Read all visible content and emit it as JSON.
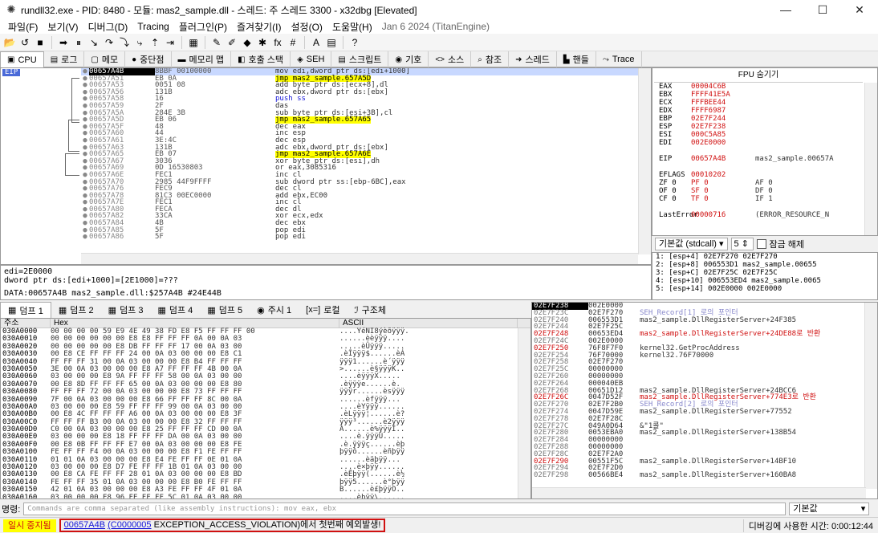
{
  "window": {
    "title": "rundll32.exe - PID: 8480 - 모듈: mas2_sample.dll - 스레드: 주 스레드 3300 - x32dbg [Elevated]",
    "buttons": [
      "—",
      "☐",
      "✕"
    ]
  },
  "menu": {
    "items": [
      "파일(F)",
      "보기(V)",
      "디버그(D)",
      "Tracing",
      "플러그인(P)",
      "즐겨찾기(I)",
      "설정(O)",
      "도움말(H)"
    ],
    "date": "Jan 6 2024 (TitanEngine)"
  },
  "toolbar": {
    "icons": [
      "open-icon",
      "restart-icon",
      "stop-icon",
      "run-icon",
      "pause-icon",
      "step-into-icon",
      "step-over-icon",
      "trace-into-icon",
      "trace-over-icon",
      "execute-till-return-icon",
      "run-to-user-code-icon",
      "scylla-icon",
      "patch-icon",
      "comment-icon",
      "label-icon",
      "bookmark-icon",
      "function-icon",
      "hash-icon",
      "font-icon",
      "calculator-icon",
      "help-icon"
    ],
    "glyphs": [
      "📂",
      "↺",
      "■",
      "➡",
      "⏸",
      "↘",
      "↷",
      "⤵",
      "⤷",
      "⇡",
      "⇥",
      "▦",
      "✎",
      "✐",
      "◆",
      "✱",
      "fx",
      "#",
      "A",
      "▤",
      "?"
    ]
  },
  "tabs": [
    {
      "label": "CPU",
      "icon": "▣"
    },
    {
      "label": "로그",
      "icon": "▤"
    },
    {
      "label": "메모",
      "icon": "▢"
    },
    {
      "label": "중단점",
      "icon": "●"
    },
    {
      "label": "메모리 맵",
      "icon": "▬"
    },
    {
      "label": "호출 스택",
      "icon": "◧"
    },
    {
      "label": "SEH",
      "icon": "◈"
    },
    {
      "label": "스크립트",
      "icon": "▤"
    },
    {
      "label": "기호",
      "icon": "◉"
    },
    {
      "label": "소스",
      "icon": "<>"
    },
    {
      "label": "참조",
      "icon": "⌕"
    },
    {
      "label": "스레드",
      "icon": "➜"
    },
    {
      "label": "핸들",
      "icon": "▙"
    },
    {
      "label": "Trace",
      "icon": "⤳"
    }
  ],
  "disasm": {
    "eip_label": "EIP",
    "rows": [
      {
        "addr": "00657A4B",
        "bytes": "8BBF 00100000",
        "ins": "mov edi,dword ptr ds:[edi+1000]",
        "kind": "cur"
      },
      {
        "addr": "00657A51",
        "bytes": "EB 0A",
        "ins": "jmp mas2_sample.657A5D",
        "kind": "jmp"
      },
      {
        "addr": "00657A53",
        "bytes": "0051 08",
        "ins": "add byte ptr ds:[ecx+8],dl",
        "kind": ""
      },
      {
        "addr": "00657A56",
        "bytes": "131B",
        "ins": "adc ebx,dword ptr ds:[ebx]",
        "kind": ""
      },
      {
        "addr": "00657A58",
        "bytes": "16",
        "ins": "push ss",
        "kind": "push"
      },
      {
        "addr": "00657A59",
        "bytes": "2F",
        "ins": "das",
        "kind": ""
      },
      {
        "addr": "00657A5A",
        "bytes": "284E 3B",
        "ins": "sub byte ptr ds:[esi+3B],cl",
        "kind": ""
      },
      {
        "addr": "00657A5D",
        "bytes": "EB 06",
        "ins": "jmp mas2_sample.657A65",
        "kind": "jmp"
      },
      {
        "addr": "00657A5F",
        "bytes": "48",
        "ins": "dec eax",
        "kind": ""
      },
      {
        "addr": "00657A60",
        "bytes": "44",
        "ins": "inc esp",
        "kind": ""
      },
      {
        "addr": "00657A61",
        "bytes": "3E:4C",
        "ins": "dec esp",
        "kind": ""
      },
      {
        "addr": "00657A63",
        "bytes": "131B",
        "ins": "adc ebx,dword ptr ds:[ebx]",
        "kind": ""
      },
      {
        "addr": "00657A65",
        "bytes": "EB 07",
        "ins": "jmp mas2_sample.657A6E",
        "kind": "jmp"
      },
      {
        "addr": "00657A67",
        "bytes": "3036",
        "ins": "xor byte ptr ds:[esi],dh",
        "kind": ""
      },
      {
        "addr": "00657A69",
        "bytes": "0D 16530803",
        "ins": "or eax,3085316",
        "kind": ""
      },
      {
        "addr": "00657A6E",
        "bytes": "FEC1",
        "ins": "inc cl",
        "kind": ""
      },
      {
        "addr": "00657A70",
        "bytes": "2985 44F9FFFF",
        "ins": "sub dword ptr ss:[ebp-6BC],eax",
        "kind": ""
      },
      {
        "addr": "00657A76",
        "bytes": "FEC9",
        "ins": "dec cl",
        "kind": ""
      },
      {
        "addr": "00657A78",
        "bytes": "81C3 00EC0000",
        "ins": "add ebx,EC00",
        "kind": ""
      },
      {
        "addr": "00657A7E",
        "bytes": "FEC1",
        "ins": "inc cl",
        "kind": ""
      },
      {
        "addr": "00657A80",
        "bytes": "FECA",
        "ins": "dec dl",
        "kind": ""
      },
      {
        "addr": "00657A82",
        "bytes": "33CA",
        "ins": "xor ecx,edx",
        "kind": ""
      },
      {
        "addr": "00657A84",
        "bytes": "4B",
        "ins": "dec ebx",
        "kind": ""
      },
      {
        "addr": "00657A85",
        "bytes": "5F",
        "ins": "pop edi",
        "kind": ""
      },
      {
        "addr": "00657A86",
        "bytes": "5F",
        "ins": "pop edi",
        "kind": ""
      }
    ]
  },
  "info": {
    "line1": "edi=2E0000",
    "line2": "dword ptr ds:[edi+1000]=[2E1000]=???",
    "line3": "DATA:00657A4B mas2_sample.dll:$257A4B #24E44B"
  },
  "fpu": {
    "header": "FPU 숨기기",
    "regs": [
      {
        "n": "EAX",
        "v": "00004C6B",
        "x": ""
      },
      {
        "n": "EBX",
        "v": "FFFF41E5A",
        "x": ""
      },
      {
        "n": "ECX",
        "v": "FFFBEE44",
        "x": ""
      },
      {
        "n": "EDX",
        "v": "FFFF6987",
        "x": ""
      },
      {
        "n": "EBP",
        "v": "02E7F244",
        "x": ""
      },
      {
        "n": "ESP",
        "v": "02E7F238",
        "x": ""
      },
      {
        "n": "ESI",
        "v": "000C5A85",
        "x": ""
      },
      {
        "n": "EDI",
        "v": "002E0000",
        "x": ""
      },
      {
        "n": "",
        "v": "",
        "x": ""
      },
      {
        "n": "EIP",
        "v": "00657A4B",
        "x": "mas2_sample.00657A"
      },
      {
        "n": "",
        "v": "",
        "x": ""
      },
      {
        "n": "EFLAGS",
        "v": "00010202",
        "x": ""
      },
      {
        "n": "ZF 0",
        "v": "PF 0",
        "x": "AF 0"
      },
      {
        "n": "OF 0",
        "v": "SF 0",
        "x": "DF 0"
      },
      {
        "n": "CF 0",
        "v": "TF 0",
        "x": "IF 1"
      },
      {
        "n": "",
        "v": "",
        "x": ""
      },
      {
        "n": "LastError",
        "v": "00000716",
        "x": "(ERROR_RESOURCE_N"
      }
    ]
  },
  "callconv": {
    "label": "기본값 (stdcall)",
    "count": "5",
    "lock_label": "잠금 해제"
  },
  "args": [
    "1: [esp+4] 02E7F270 02E7F270",
    "2: [esp+8] 006553D1 mas2_sample.00655",
    "3: [esp+C] 02E7F25C 02E7F25C",
    "4: [esp+10] 006553ED4 mas2_sample.0065",
    "5: [esp+14] 002E0000 002E0000"
  ],
  "dump_tabs": [
    {
      "label": "덤프 1",
      "icon": "▦"
    },
    {
      "label": "덤프 2",
      "icon": "▦"
    },
    {
      "label": "덤프 3",
      "icon": "▦"
    },
    {
      "label": "덤프 4",
      "icon": "▦"
    },
    {
      "label": "덤프 5",
      "icon": "▦"
    },
    {
      "label": "주시 1",
      "icon": "◉"
    },
    {
      "label": "로컬",
      "icon": "[x=]"
    },
    {
      "label": "구조체",
      "icon": "ℐ"
    }
  ],
  "dump": {
    "headers": [
      "주소",
      "Hex",
      "ASCII"
    ],
    "rows": [
      {
        "a": "030A0000",
        "h": "00 00 00 00 59 E9 4E 49 38 FD E8 F5 FF FF FF 00",
        "t": "....YéNI8ýèõÿÿÿ."
      },
      {
        "a": "030A0010",
        "h": "00 00 00 00 00 00 E8 E8 FF FF FF 0A 00 0A 03",
        "t": "......èèÿÿÿ...."
      },
      {
        "a": "030A0020",
        "h": "00 00 00 00 00 E8 DB FF FF FF 17 00 0A 03 00",
        "t": ".....èÛÿÿÿ....."
      },
      {
        "a": "030A0030",
        "h": "00 E8 CE FF FF FF 24 00 0A 03 00 00 00 E8 C1",
        "t": ".èÎÿÿÿ$......èÁ"
      },
      {
        "a": "030A0040",
        "h": "FF FF FF 31 00 0A 03 00 00 00 E8 B4 FF FF FF",
        "t": "ÿÿÿ1......è´ÿÿÿ"
      },
      {
        "a": "030A0050",
        "h": "3E 00 0A 03 00 00 00 E8 A7 FF FF FF 4B 00 0A",
        "t": ">......è§ÿÿÿK.."
      },
      {
        "a": "030A0060",
        "h": "03 00 00 00 E8 9A FF FF FF 58 00 0A 03 00 00",
        "t": "....èÿÿÿX....."
      },
      {
        "a": "030A0070",
        "h": "00 E8 8D FF FF FF 65 00 0A 03 00 00 00 E8 80",
        "t": ".èÿÿÿe......è."
      },
      {
        "a": "030A0080",
        "h": "FF FF FF 72 00 0A 03 00 00 00 E8 73 FF FF FF",
        "t": "ÿÿÿr......èsÿÿÿ"
      },
      {
        "a": "030A0090",
        "h": "7F 00 0A 03 00 00 00 E8 66 FF FF FF 8C 00 0A",
        "t": "......èfÿÿÿ..."
      },
      {
        "a": "030A00A0",
        "h": "03 00 00 00 E8 59 FF FF FF 99 00 0A 03 00 00",
        "t": "....èYÿÿÿ......"
      },
      {
        "a": "030A00B0",
        "h": "00 E8 4C FF FF FF A6 00 0A 03 00 00 00 E8 3F",
        "t": ".èLÿÿÿ¦......è?"
      },
      {
        "a": "030A00C0",
        "h": "FF FF FF B3 00 0A 03 00 00 00 E8 32 FF FF FF",
        "t": "ÿÿÿ³......è2ÿÿÿ"
      },
      {
        "a": "030A00D0",
        "h": "C0 00 0A 03 00 00 00 E8 25 FF FF FF CD 00 0A",
        "t": "À......è%ÿÿÿÍ.."
      },
      {
        "a": "030A00E0",
        "h": "03 00 00 00 E8 18 FF FF FF DA 00 0A 03 00 00",
        "t": "....è.ÿÿÿÚ....."
      },
      {
        "a": "030A00F0",
        "h": "00 E8 0B FF FF FF E7 00 0A 03 00 00 00 E8 FE",
        "t": ".è.ÿÿÿç......èþ"
      },
      {
        "a": "030A0100",
        "h": "FE FF FF F4 00 0A 03 00 00 00 E8 F1 FE FF FF",
        "t": "þÿÿô......èñþÿÿ"
      },
      {
        "a": "030A0110",
        "h": "01 01 0A 03 00 00 00 E8 E4 FE FF FF 0E 01 0A",
        "t": "......èäþÿÿ..."
      },
      {
        "a": "030A0120",
        "h": "03 00 00 00 E8 D7 FE FF FF 1B 01 0A 03 00 00",
        "t": "....è×þÿÿ......"
      },
      {
        "a": "030A0130",
        "h": "00 E8 CA FE FF FF 28 01 0A 03 00 00 00 E8 BD",
        "t": ".èÊþÿÿ(......è½"
      },
      {
        "a": "030A0140",
        "h": "FE FF FF 35 01 0A 03 00 00 00 E8 B0 FE FF FF",
        "t": "þÿÿ5......è°þÿÿ"
      },
      {
        "a": "030A0150",
        "h": "42 01 0A 03 00 00 00 E8 A3 FE FF FF 4F 01 0A",
        "t": "B......è£þÿÿO.."
      },
      {
        "a": "030A0160",
        "h": "03 00 00 00 E8 96 FE FF FF 5C 01 0A 03 00 00",
        "t": "....èþÿÿ\\......"
      }
    ]
  },
  "stack": {
    "rows": [
      {
        "a": "02E7F238",
        "v": "002E0000",
        "c": "",
        "k": "top"
      },
      {
        "a": "02E7F23C",
        "v": "02E7F270",
        "c": "SEH_Record[1] 로의 포인터",
        "k": "seh"
      },
      {
        "a": "02E7F240",
        "v": "006553D1",
        "c": "mas2_sample.DllRegisterServer+24F385",
        "k": ""
      },
      {
        "a": "02E7F244",
        "v": "02E7F25C",
        "c": "",
        "k": ""
      },
      {
        "a": "02E7F248",
        "v": "00653ED4",
        "c": "mas2_sample.DllRegisterServer+24DE88로 반환",
        "k": "redc"
      },
      {
        "a": "02E7F24C",
        "v": "002E0000",
        "c": "",
        "k": ""
      },
      {
        "a": "02E7F250",
        "v": "76F8F7F0",
        "c": "kernel32.GetProcAddress",
        "k": "red"
      },
      {
        "a": "02E7F254",
        "v": "76F70000",
        "c": "kernel32.76F70000",
        "k": ""
      },
      {
        "a": "02E7F258",
        "v": "02E7F270",
        "c": "",
        "k": ""
      },
      {
        "a": "02E7F25C",
        "v": "00000000",
        "c": "",
        "k": ""
      },
      {
        "a": "02E7F260",
        "v": "00000000",
        "c": "",
        "k": ""
      },
      {
        "a": "02E7F264",
        "v": "000040EB",
        "c": "",
        "k": ""
      },
      {
        "a": "02E7F268",
        "v": "00651D12",
        "c": "mas2_sample.DllRegisterServer+24BCC6",
        "k": ""
      },
      {
        "a": "02E7F26C",
        "v": "0047D52F",
        "c": "mas2_sample.DllRegisterServer+774E3로 반환",
        "k": "redc"
      },
      {
        "a": "02E7F270",
        "v": "02E7F2B0",
        "c": "SEH_Record[2] 로의 포인터",
        "k": "seh"
      },
      {
        "a": "02E7F274",
        "v": "0047D59E",
        "c": "mas2_sample.DllRegisterServer+77552",
        "k": ""
      },
      {
        "a": "02E7F278",
        "v": "02E7F28C",
        "c": "",
        "k": ""
      },
      {
        "a": "02E7F27C",
        "v": "049A0D64",
        "c": "&\"1콜\"",
        "k": ""
      },
      {
        "a": "02E7F280",
        "v": "0053EBA0",
        "c": "mas2_sample.DllRegisterServer+138B54",
        "k": ""
      },
      {
        "a": "02E7F284",
        "v": "00000000",
        "c": "",
        "k": ""
      },
      {
        "a": "02E7F288",
        "v": "00000000",
        "c": "",
        "k": ""
      },
      {
        "a": "02E7F28C",
        "v": "02E7F2A0",
        "c": "",
        "k": ""
      },
      {
        "a": "02E7F290",
        "v": "00551F5C",
        "c": "mas2_sample.DllRegisterServer+14BF10",
        "k": "red"
      },
      {
        "a": "02E7F294",
        "v": "02E7F2D0",
        "c": "",
        "k": ""
      },
      {
        "a": "02E7F298",
        "v": "00566BE4",
        "c": "mas2_sample.DllRegisterServer+160BA8",
        "k": ""
      }
    ]
  },
  "cmd": {
    "label": "명령:",
    "placeholder": "Commands are comma separated (like assembly instructions): mov eax, ebx",
    "mode": "기본값"
  },
  "status": {
    "state": "일시 중지됨",
    "msg_addr": "00657A4B",
    "msg_code": "(C0000005",
    "msg_rest": " EXCEPTION_ACCESS_VIOLATION)에서 첫번째 예외발생!",
    "time": "디버깅에 사용한 시간: 0:00:12:44"
  }
}
